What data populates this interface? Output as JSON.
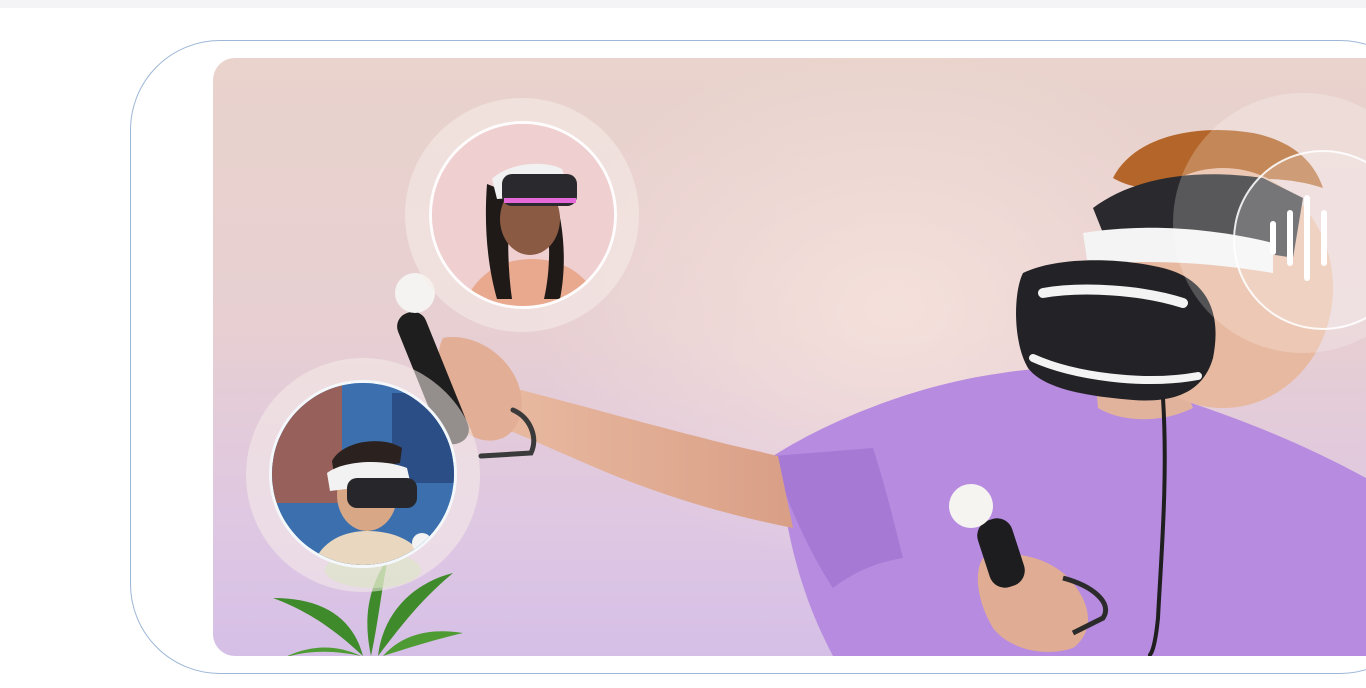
{
  "page": {
    "description_free": true
  },
  "hero_image": {
    "alt": "",
    "icons": {
      "voice": "audio-waveform-icon"
    },
    "colors": {
      "frame_border": "#9db7d6",
      "background_top": "#e9d3cc",
      "background_bottom": "#d5bfe6",
      "shirt": "#b98ee0"
    }
  }
}
